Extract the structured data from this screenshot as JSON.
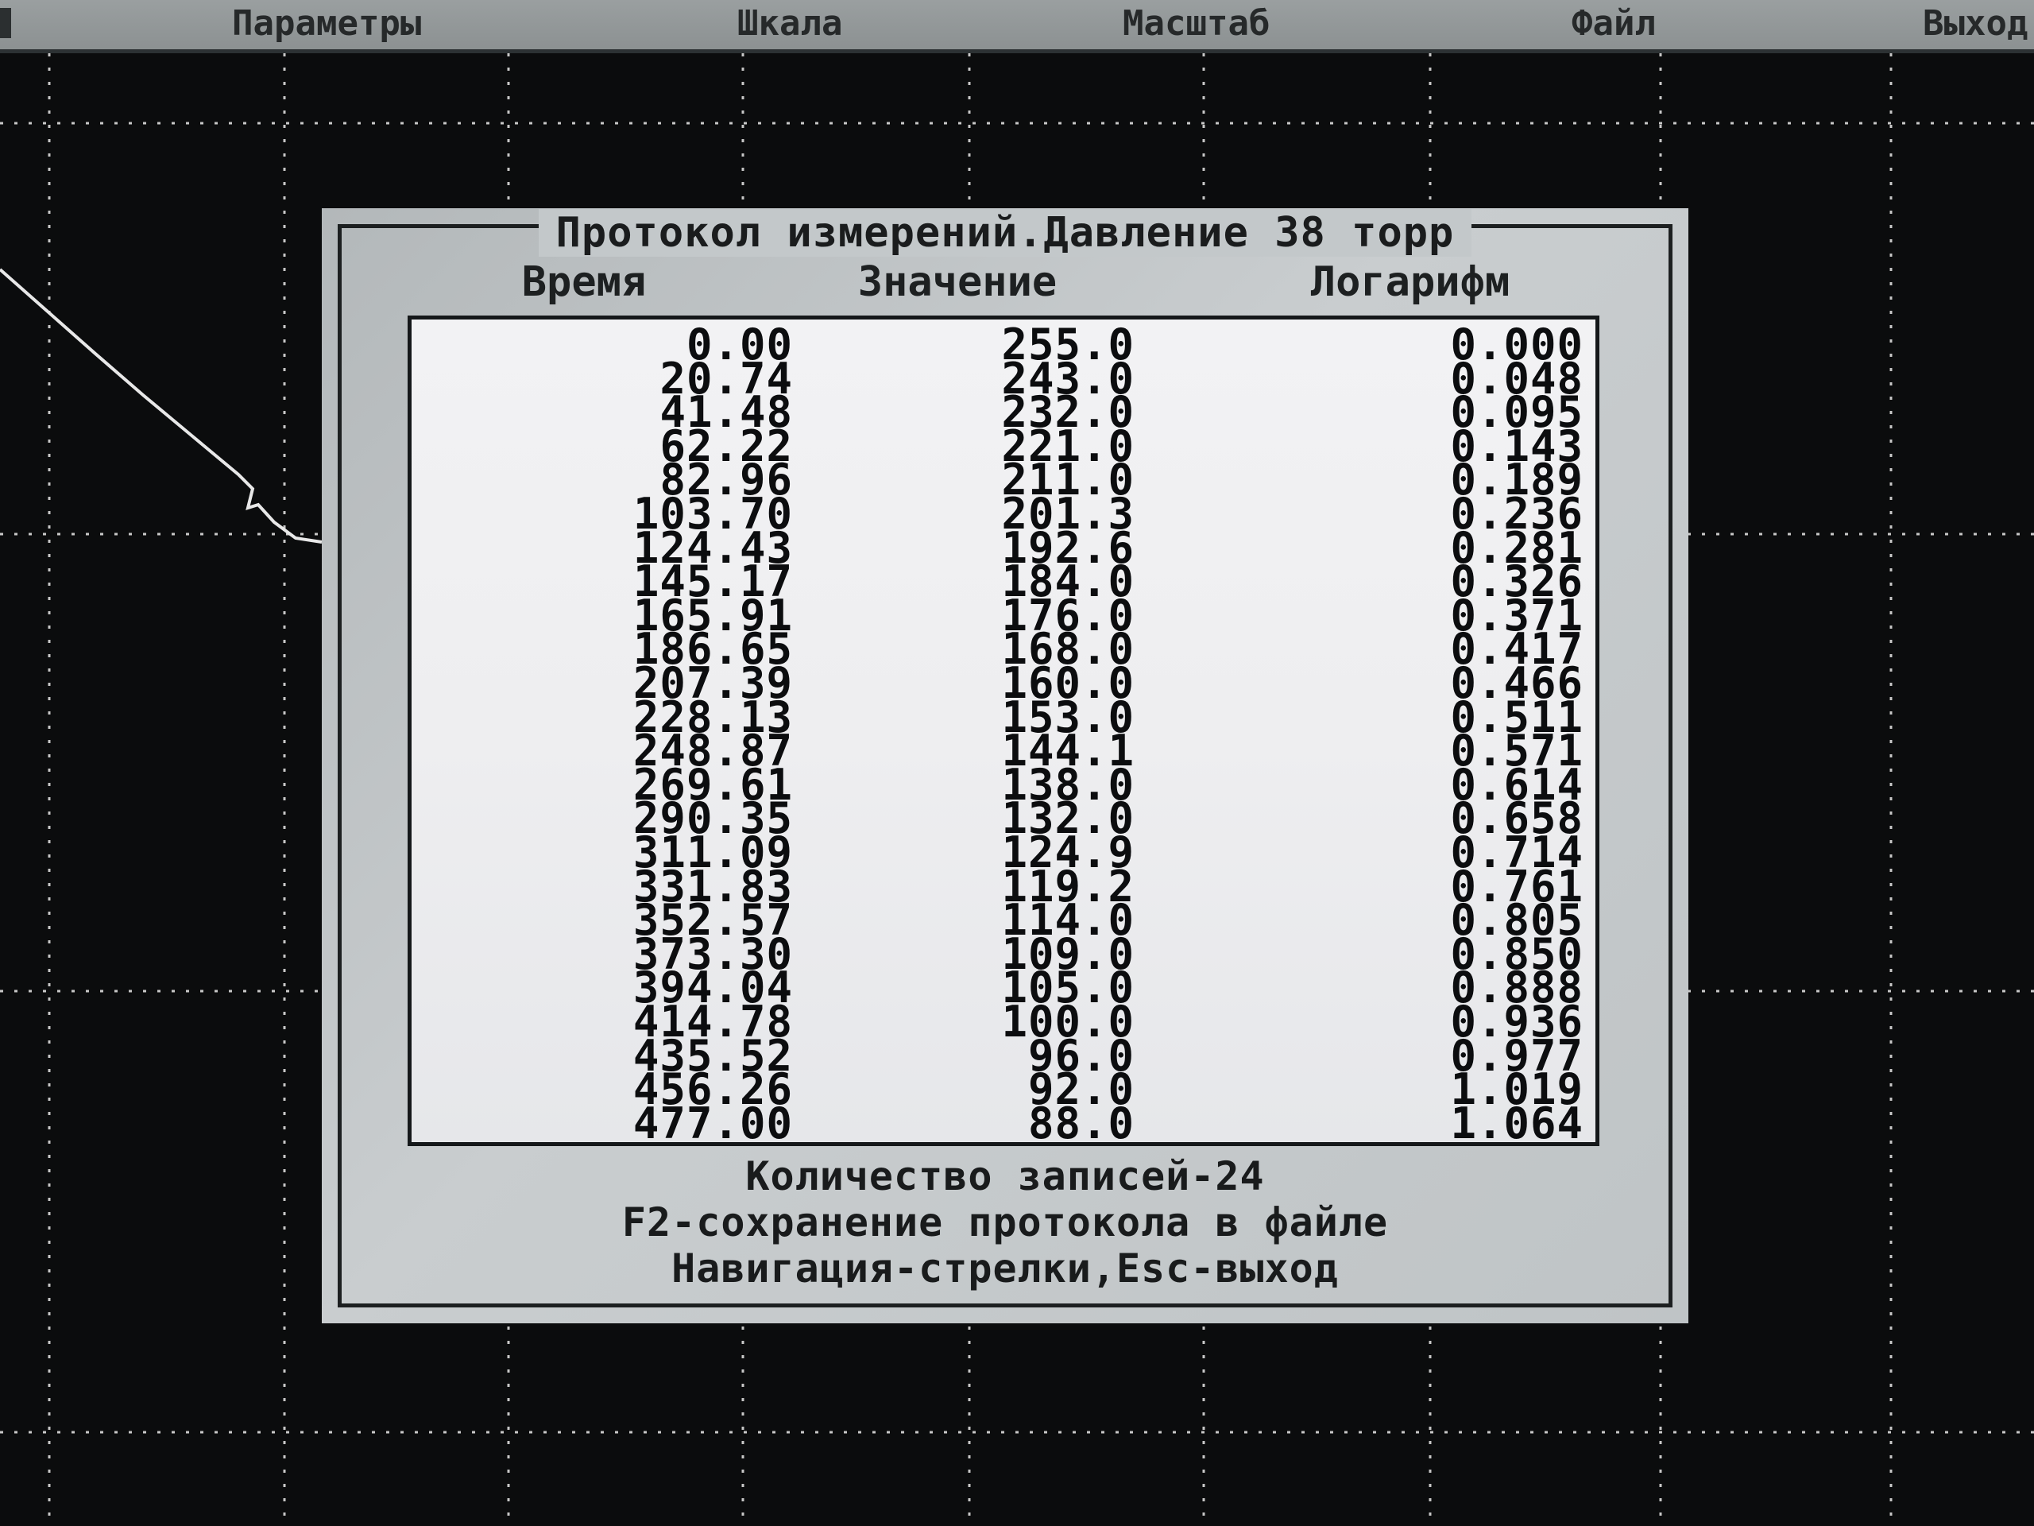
{
  "menu": {
    "items": [
      "Параметры",
      "Шкала",
      "Масштаб",
      "Файл",
      "Выход"
    ]
  },
  "dialog": {
    "title": "Протокол измерений.Давление 38 торр",
    "headers": {
      "time": "Время",
      "value": "Значение",
      "log": "Логарифм"
    },
    "rows": [
      {
        "time": "0.00",
        "value": "255.0",
        "log": "0.000"
      },
      {
        "time": "20.74",
        "value": "243.0",
        "log": "0.048"
      },
      {
        "time": "41.48",
        "value": "232.0",
        "log": "0.095"
      },
      {
        "time": "62.22",
        "value": "221.0",
        "log": "0.143"
      },
      {
        "time": "82.96",
        "value": "211.0",
        "log": "0.189"
      },
      {
        "time": "103.70",
        "value": "201.3",
        "log": "0.236"
      },
      {
        "time": "124.43",
        "value": "192.6",
        "log": "0.281"
      },
      {
        "time": "145.17",
        "value": "184.0",
        "log": "0.326"
      },
      {
        "time": "165.91",
        "value": "176.0",
        "log": "0.371"
      },
      {
        "time": "186.65",
        "value": "168.0",
        "log": "0.417"
      },
      {
        "time": "207.39",
        "value": "160.0",
        "log": "0.466"
      },
      {
        "time": "228.13",
        "value": "153.0",
        "log": "0.511"
      },
      {
        "time": "248.87",
        "value": "144.1",
        "log": "0.571"
      },
      {
        "time": "269.61",
        "value": "138.0",
        "log": "0.614"
      },
      {
        "time": "290.35",
        "value": "132.0",
        "log": "0.658"
      },
      {
        "time": "311.09",
        "value": "124.9",
        "log": "0.714"
      },
      {
        "time": "331.83",
        "value": "119.2",
        "log": "0.761"
      },
      {
        "time": "352.57",
        "value": "114.0",
        "log": "0.805"
      },
      {
        "time": "373.30",
        "value": "109.0",
        "log": "0.850"
      },
      {
        "time": "394.04",
        "value": "105.0",
        "log": "0.888"
      },
      {
        "time": "414.78",
        "value": "100.0",
        "log": "0.936"
      },
      {
        "time": "435.52",
        "value": "96.0",
        "log": "0.977"
      },
      {
        "time": "456.26",
        "value": "92.0",
        "log": "1.019"
      },
      {
        "time": "477.00",
        "value": "88.0",
        "log": "1.064"
      }
    ],
    "record_count": "Количество записей-24",
    "save_hint": "F2-сохранение протокола в файле",
    "nav_hint": "Навигация-стрелки,Esc-выход"
  },
  "colors": {
    "screen_bg": "#0b0c0d",
    "grid": "#c8c8c8",
    "curve": "#e8e8e8",
    "menubar": "#969b9c",
    "dialog_bg": "#c3c8ca",
    "table_bg": "#f0f0f2"
  }
}
